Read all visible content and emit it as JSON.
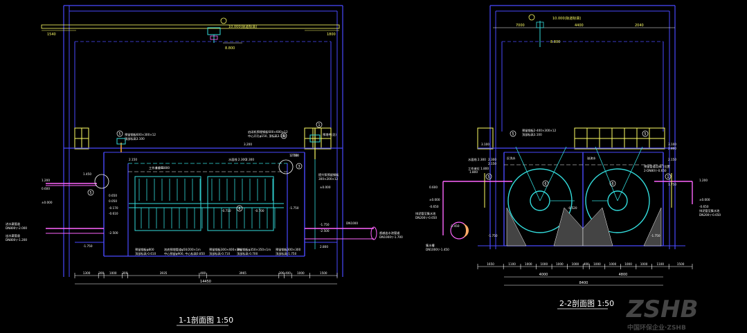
{
  "section_1": {
    "title": "1-1剖面图 1:50",
    "top_dims": [
      "1540",
      "1800"
    ],
    "elevation_top": "10.000(轨道标高)",
    "elevation_crane": "8.800",
    "callouts": [
      "5",
      "5",
      "1",
      "5",
      "3",
      "6"
    ],
    "notes": {
      "pipe_left": "预留钢板600×300×12",
      "pipe_left_2": "顶部标高3.100",
      "valve_note": "启闭机预埋钢板600×600×12",
      "valve_note_2": "中心开孔φ150, 顶标高3.100",
      "right_note": "预埋件(见)",
      "work_level": "工作液位 1.800",
      "water_level": "水面线 2.300",
      "lift_pipe": "提升泵预留钢板",
      "lift_pipe_2": "300×200×12",
      "in_pipe": "进水渠管道",
      "in_pipe_level": "DN800▽-2.000",
      "in_pipe_2": "出水渠管道",
      "in_pipe_2_level": "DN800▽-1.200",
      "overflow": "超越出水池管道",
      "overflow_level": "DN1000▽-1.700",
      "plate_note_1": "预留钢板φ800",
      "plate_note_1b": "顶部标高-0.610",
      "plate_note_2": "池底预埋管道φ50/200×1m",
      "plate_note_2b": "中心预留φ900, 中心标高0.850",
      "plate_note_3": "预留钢板300×400×1m",
      "plate_note_3b": "顶部标高-0.710",
      "plate_note_4": "预留钢板φ350×350×1m",
      "plate_note_4b": "顶部标高-0.700",
      "plate_note_5": "预留钢板300×300",
      "plate_note_5b": "顶部标高-1.750",
      "dn100": "DN1000"
    },
    "levels": [
      "3.200",
      "2.150",
      "2.300",
      "1.800",
      "1.450",
      "1.200",
      "0.600",
      "±0.000",
      "0.050",
      "-0.170",
      "-0.610",
      "-0.710",
      "-0.700",
      "-1.750",
      "-2.500",
      "-1.750",
      "-1.750",
      "-2.500",
      "2.800",
      "2.150",
      "1.750",
      "±0.000",
      "0.650"
    ],
    "bottom_dims": [
      "1300",
      "300",
      "1000",
      "300",
      "3935",
      "400",
      "3965",
      "300",
      "400",
      "1000",
      "1500"
    ],
    "total_dim": "14450"
  },
  "section_2": {
    "title": "2-2剖面图 1:50",
    "top_dims": [
      "7000",
      "4400",
      "2040"
    ],
    "elevation_top": "10.000(轨道标高)",
    "elevation_crane": "8.800",
    "callouts": [
      "5",
      "5",
      "5",
      "6",
      "6",
      "1"
    ],
    "notes": {
      "plate": "预留钢板2-400×300×12",
      "plate_2": "顶部标高3.100",
      "work_level": "工作液位 1.800",
      "water_level": "水面线 2.300",
      "left_label": "反洗水",
      "right_label": "溢流水",
      "right_note": "预留管道及阀门位置",
      "right_note_2": "2-DN80▽-0.650",
      "sewage_left": "排泥管至集水池",
      "sewage_left_2": "DN200▽-0.650",
      "drain": "集水槽",
      "drain_level": "DN1000▽-1.450",
      "sewage_right": "排泥管至集水池",
      "sewage_right_2": "DN200▽-0.650",
      "center_level": "-0.520"
    },
    "levels": [
      "3.100",
      "2.300",
      "2.150",
      "1.800",
      "0.600",
      "±0.000",
      "-0.650",
      "-1.450",
      "-1.750",
      "-1.750",
      "3.100",
      "2.800",
      "2.150",
      "1.750",
      "1.200",
      "±0.000",
      "-0.650"
    ],
    "bottom_dims": [
      "1650",
      "1100",
      "1000",
      "1000",
      "1000",
      "1000",
      "400",
      "1000",
      "1000",
      "1000",
      "1000",
      "1100",
      "1500"
    ],
    "mid_dims": [
      "4000",
      "4800"
    ],
    "total_dim": "8400"
  },
  "watermark": {
    "logo": "ZSHB",
    "sub": "中国环保企业·ZSHB"
  }
}
